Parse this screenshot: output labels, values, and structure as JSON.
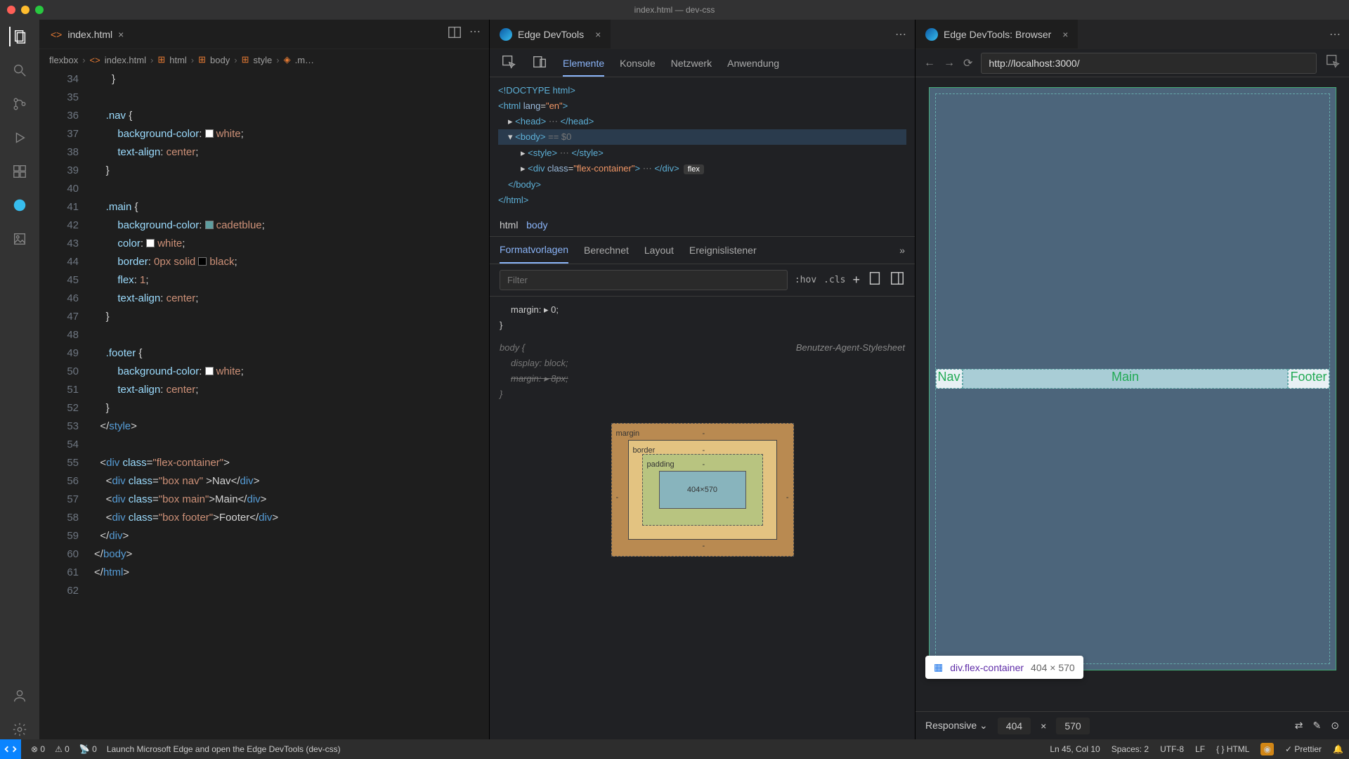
{
  "window_title": "index.html — dev-css",
  "editor": {
    "tab": {
      "filename": "index.html"
    },
    "breadcrumb": [
      "flexbox",
      "index.html",
      "html",
      "body",
      "style",
      ".m…"
    ],
    "lines": [
      {
        "n": 34,
        "html": "      <span class='pun'>}</span>"
      },
      {
        "n": 35,
        "html": ""
      },
      {
        "n": 36,
        "html": "    <span class='sel'>.nav</span> <span class='pun'>{</span>"
      },
      {
        "n": 37,
        "html": "        <span class='prop'>background-color</span><span class='pun'>:</span> <span class='swatch' style='background:#fff'></span><span class='val'>white</span><span class='pun'>;</span>"
      },
      {
        "n": 38,
        "html": "        <span class='prop'>text-align</span><span class='pun'>:</span> <span class='val'>center</span><span class='pun'>;</span>"
      },
      {
        "n": 39,
        "html": "    <span class='pun'>}</span>"
      },
      {
        "n": 40,
        "html": ""
      },
      {
        "n": 41,
        "html": "    <span class='sel'>.main</span> <span class='pun'>{</span>"
      },
      {
        "n": 42,
        "html": "        <span class='prop'>background-color</span><span class='pun'>:</span> <span class='swatch' style='background:cadetblue'></span><span class='val'>cadetblue</span><span class='pun'>;</span>"
      },
      {
        "n": 43,
        "html": "        <span class='prop'>color</span><span class='pun'>:</span> <span class='swatch' style='background:#fff'></span><span class='val'>white</span><span class='pun'>;</span>"
      },
      {
        "n": 44,
        "html": "        <span class='prop'>border</span><span class='pun'>:</span> <span class='val'>0px solid </span><span class='swatch' style='background:#000'></span><span class='val'>black</span><span class='pun'>;</span>"
      },
      {
        "n": 45,
        "html": "        <span class='prop'>flex</span><span class='pun'>:</span> <span class='val'>1</span><span class='pun'>;</span>"
      },
      {
        "n": 46,
        "html": "        <span class='prop'>text-align</span><span class='pun'>:</span> <span class='val'>center</span><span class='pun'>;</span>"
      },
      {
        "n": 47,
        "html": "    <span class='pun'>}</span>"
      },
      {
        "n": 48,
        "html": ""
      },
      {
        "n": 49,
        "html": "    <span class='sel'>.footer</span> <span class='pun'>{</span>"
      },
      {
        "n": 50,
        "html": "        <span class='prop'>background-color</span><span class='pun'>:</span> <span class='swatch' style='background:#fff'></span><span class='val'>white</span><span class='pun'>;</span>"
      },
      {
        "n": 51,
        "html": "        <span class='prop'>text-align</span><span class='pun'>:</span> <span class='val'>center</span><span class='pun'>;</span>"
      },
      {
        "n": 52,
        "html": "    <span class='pun'>}</span>"
      },
      {
        "n": 53,
        "html": "  <span class='pun'>&lt;/</span><span class='tag'>style</span><span class='pun'>&gt;</span>"
      },
      {
        "n": 54,
        "html": ""
      },
      {
        "n": 55,
        "html": "  <span class='pun'>&lt;</span><span class='tag'>div</span> <span class='attr'>class</span><span class='pun'>=</span><span class='str'>\"flex-container\"</span><span class='pun'>&gt;</span>"
      },
      {
        "n": 56,
        "html": "    <span class='pun'>&lt;</span><span class='tag'>div</span> <span class='attr'>class</span><span class='pun'>=</span><span class='str'>\"box nav\"</span> <span class='pun'>&gt;</span><span class='txt'>Nav</span><span class='pun'>&lt;/</span><span class='tag'>div</span><span class='pun'>&gt;</span>"
      },
      {
        "n": 57,
        "html": "    <span class='pun'>&lt;</span><span class='tag'>div</span> <span class='attr'>class</span><span class='pun'>=</span><span class='str'>\"box main\"</span><span class='pun'>&gt;</span><span class='txt'>Main</span><span class='pun'>&lt;/</span><span class='tag'>div</span><span class='pun'>&gt;</span>"
      },
      {
        "n": 58,
        "html": "    <span class='pun'>&lt;</span><span class='tag'>div</span> <span class='attr'>class</span><span class='pun'>=</span><span class='str'>\"box footer\"</span><span class='pun'>&gt;</span><span class='txt'>Footer</span><span class='pun'>&lt;/</span><span class='tag'>div</span><span class='pun'>&gt;</span>"
      },
      {
        "n": 59,
        "html": "  <span class='pun'>&lt;/</span><span class='tag'>div</span><span class='pun'>&gt;</span>"
      },
      {
        "n": 60,
        "html": "<span class='pun'>&lt;/</span><span class='tag'>body</span><span class='pun'>&gt;</span>"
      },
      {
        "n": 61,
        "html": "<span class='pun'>&lt;/</span><span class='tag'>html</span><span class='pun'>&gt;</span>"
      },
      {
        "n": 62,
        "html": ""
      }
    ]
  },
  "devtools": {
    "tab_title": "Edge DevTools",
    "toolbar": [
      "Elemente",
      "Konsole",
      "Netzwerk",
      "Anwendung"
    ],
    "dom_breadcrumb": [
      "html",
      "body"
    ],
    "style_tabs": [
      "Formatvorlagen",
      "Berechnet",
      "Layout",
      "Ereignislistener"
    ],
    "filter_placeholder": "Filter",
    "hov": ":hov",
    "cls": ".cls",
    "rule1": "margin: ▸ 0;",
    "rule2_sel": "body {",
    "rule2_ua": "Benutzer-Agent-Stylesheet",
    "rule2a": "display: block;",
    "rule2b": "margin: ▸ 8px;",
    "boxmodel": {
      "margin": "margin",
      "border": "border",
      "padding": "padding",
      "content": "404×570"
    }
  },
  "browser": {
    "tab_title": "Edge DevTools: Browser",
    "url": "http://localhost:3000/",
    "flex": {
      "nav": "Nav",
      "main": "Main",
      "footer": "Footer"
    },
    "tooltip": {
      "selector": "div.flex-container",
      "dims": "404 × 570"
    },
    "responsive": "Responsive",
    "width": "404",
    "height": "570"
  },
  "status": {
    "errors": "0",
    "warnings": "0",
    "ports": "0",
    "launch": "Launch Microsoft Edge and open the Edge DevTools (dev-css)",
    "cursor": "Ln 45, Col 10",
    "spaces": "Spaces: 2",
    "encoding": "UTF-8",
    "eol": "LF",
    "lang": "HTML",
    "prettier": "Prettier"
  }
}
